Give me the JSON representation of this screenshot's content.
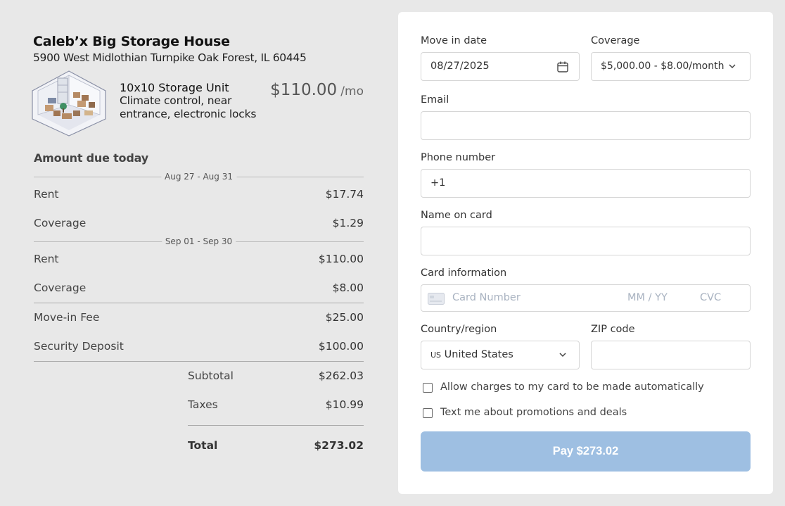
{
  "store": {
    "name": "Caleb’x Big Storage House",
    "address": "5900 West Midlothian Turnpike Oak Forest, IL 60445"
  },
  "unit": {
    "title": "10x10 Storage Unit",
    "description": "Climate control, near entrance, electronic locks",
    "price": "$110.00",
    "per": "/mo",
    "image_icon": "storage-unit-illustration"
  },
  "due": {
    "title": "Amount due today",
    "periods": [
      {
        "label": "Aug 27 - Aug 31",
        "rows": [
          {
            "label": "Rent",
            "value": "$17.74"
          },
          {
            "label": "Coverage",
            "value": "$1.29"
          }
        ]
      },
      {
        "label": "Sep 01 - Sep 30",
        "rows": [
          {
            "label": "Rent",
            "value": "$110.00"
          },
          {
            "label": "Coverage",
            "value": "$8.00"
          }
        ]
      }
    ],
    "fees": [
      {
        "label": "Move-in Fee",
        "value": "$25.00"
      },
      {
        "label": "Security Deposit",
        "value": "$100.00"
      }
    ],
    "subtotal_label": "Subtotal",
    "subtotal": "$262.03",
    "taxes_label": "Taxes",
    "taxes": "$10.99",
    "total_label": "Total",
    "total": "$273.02"
  },
  "form": {
    "move_in": {
      "label": "Move in date",
      "value": "08/27/2025"
    },
    "coverage": {
      "label": "Coverage",
      "value": "$5,000.00 - $8.00/month"
    },
    "email": {
      "label": "Email",
      "value": ""
    },
    "phone": {
      "label": "Phone number",
      "value": "+1"
    },
    "name": {
      "label": "Name on card",
      "value": ""
    },
    "card": {
      "label": "Card information",
      "number_placeholder": "Card Number",
      "expiry_placeholder": "MM / YY",
      "cvc_placeholder": "CVC"
    },
    "country": {
      "label": "Country/region",
      "code": "US",
      "value": "United States"
    },
    "zip": {
      "label": "ZIP code",
      "value": ""
    },
    "auto_charge": {
      "label": "Allow charges to my card to be made automatically",
      "checked": false
    },
    "promos": {
      "label": "Text me about promotions and deals",
      "checked": false
    },
    "pay_label": "Pay $273.02"
  },
  "colors": {
    "pay_button": "#9ebfe2",
    "background": "#e8e8e8",
    "panel": "#ffffff"
  }
}
